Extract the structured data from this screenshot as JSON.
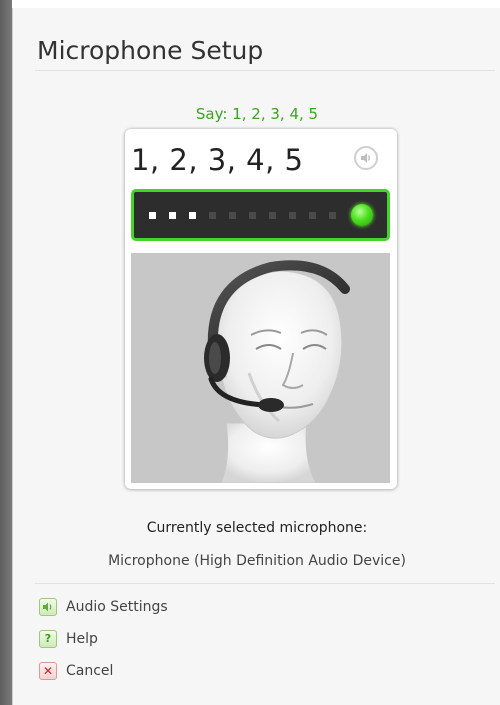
{
  "dialog": {
    "title": "Microphone Setup"
  },
  "test": {
    "prompt": "Say: 1, 2, 3, 4, 5",
    "phrase": "1, 2, 3, 4, 5",
    "level_meter": {
      "segments_total": 10,
      "segments_lit": 3,
      "status_color": "#4de01f"
    },
    "accent_color": "#3aa51c"
  },
  "microphone": {
    "label": "Currently selected microphone:",
    "name": "Microphone (High Definition Audio Device)"
  },
  "actions": [
    {
      "icon": "speaker-icon",
      "label": "Audio Settings"
    },
    {
      "icon": "help-icon",
      "label": "Help",
      "glyph": "?"
    },
    {
      "icon": "cancel-icon",
      "label": "Cancel",
      "glyph": "✕"
    }
  ]
}
